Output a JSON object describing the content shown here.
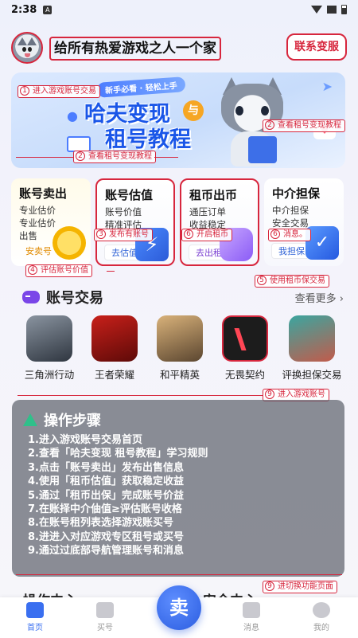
{
  "status_bar": {
    "time": "2:38",
    "notif_letter": "A"
  },
  "header": {
    "slogan": "给所有热爱游戏之人一个家",
    "contact_label": "联系变服"
  },
  "banner": {
    "tag": "新手必看 · 轻松上手",
    "title_line1": "哈夫变现",
    "title_badge": "与",
    "title_line2": "租号教程"
  },
  "annotations": {
    "a1": {
      "num": "1",
      "text": "进入游戏账号交易"
    },
    "a2": {
      "num": "2",
      "text": "查看租号变现教程"
    },
    "a2b": {
      "num": "2",
      "text": "查看租号变现教程"
    },
    "a3": {
      "num": "3",
      "text": "发布有账号"
    },
    "a6a": {
      "num": "6",
      "text": "开启租币"
    },
    "a6b": {
      "num": "6",
      "text": "消息。"
    },
    "a4": {
      "num": "4",
      "text": "评估账号价值"
    },
    "a5": {
      "num": "5",
      "text": "使用租币保交易"
    },
    "a9a": {
      "num": "9",
      "text": "进入游戏账号"
    },
    "a9b": {
      "num": "9",
      "text": "进切换功能页面"
    }
  },
  "features": [
    {
      "title": "账号卖出",
      "lines": [
        "专业估价",
        "专业估价",
        "出售"
      ],
      "button": "安卖号"
    },
    {
      "title": "账号估值",
      "lines": [
        "账号价值",
        "精准评估"
      ],
      "button": "去估值",
      "icon_glyph": "⚡"
    },
    {
      "title": "租币出币",
      "lines": [
        "通压订单",
        "收益稳定"
      ],
      "button": "去出租"
    },
    {
      "title": "中介担保",
      "lines": [
        "中介担保",
        "安全交易"
      ],
      "button": "我担保",
      "icon_glyph": "✓"
    }
  ],
  "trade": {
    "title": "账号交易",
    "more": "查看更多 ›",
    "games": [
      {
        "name": "三角洲行动"
      },
      {
        "name": "王者荣耀"
      },
      {
        "name": "和平精英"
      },
      {
        "name": "无畏契约"
      },
      {
        "name": "评换担保交易"
      }
    ]
  },
  "steps": {
    "title": "操作步骤",
    "items": [
      "1.进入游戏账号交易首页",
      "2.查看「哈夫变现 租号教程」学习规则",
      "3.点击「账号卖出」发布出售信息",
      "4.使用「租币估值」获取稳定收益",
      "5.通过「租币出保」完成账号价益",
      "7.在账择中介伷值≥评估账号收格",
      "8.在账号租列表选择游戏账买号",
      "8.进进入对应游戏专区租号或买号",
      "9.通过过底部导航管理账号和消息"
    ]
  },
  "peek": {
    "left": "操作中心",
    "right": "安全中心"
  },
  "tabbar": {
    "tabs": [
      "首页",
      "买号",
      "消息",
      "我的"
    ],
    "sell_label": "卖"
  },
  "colors": {
    "accent": "#3a6ff0",
    "annotation": "#d7263d"
  }
}
